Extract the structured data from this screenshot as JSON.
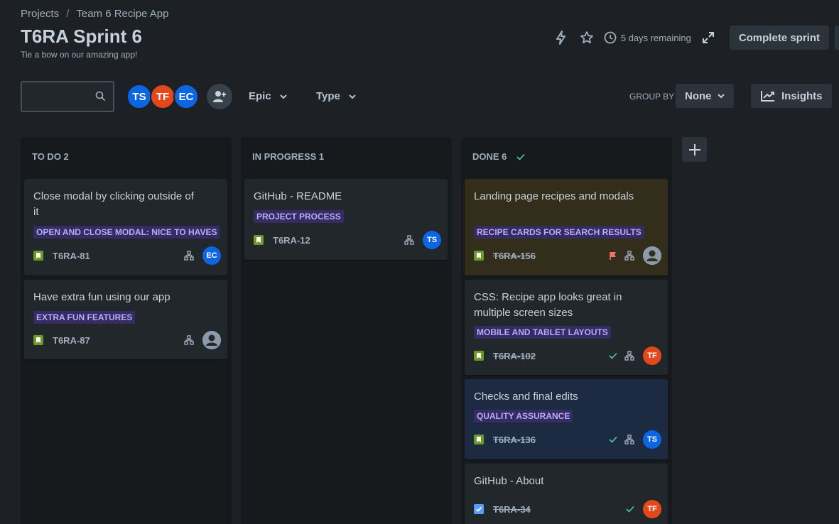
{
  "breadcrumb": {
    "root": "Projects",
    "separator": "/",
    "project": "Team 6 Recipe App"
  },
  "sprint": {
    "title": "T6RA Sprint 6",
    "goal": "Tie a bow on our amazing app!"
  },
  "top_actions": {
    "remaining": "5 days remaining",
    "complete_label": "Complete sprint"
  },
  "search": {
    "placeholder": ""
  },
  "members": [
    {
      "initials": "TS",
      "color": "#0c66e4"
    },
    {
      "initials": "TF",
      "color": "#e2481b"
    },
    {
      "initials": "EC",
      "color": "#0c66e4"
    }
  ],
  "filters": {
    "epic": "Epic",
    "type": "Type"
  },
  "group_by": {
    "label": "GROUP BY",
    "value": "None"
  },
  "insights_label": "Insights",
  "columns": [
    {
      "header": "TO DO 2",
      "cards": [
        {
          "title": "Close modal by clicking outside of it",
          "epic": "OPEN AND CLOSE MODAL: NICE TO HAVES",
          "key": "T6RA-81",
          "assignee": "EC"
        },
        {
          "title": "Have extra fun using our app",
          "epic": "EXTRA FUN FEATURES",
          "key": "T6RA-87",
          "assignee": ""
        }
      ]
    },
    {
      "header": "IN PROGRESS 1",
      "cards": [
        {
          "title": "GitHub - README",
          "epic": "PROJECT PROCESS",
          "key": "T6RA-12",
          "assignee": "TS"
        }
      ]
    },
    {
      "header": "DONE 6",
      "cards": [
        {
          "title": "Landing page recipes and modals",
          "epic": "RECIPE CARDS FOR SEARCH RESULTS",
          "key": "T6RA-156",
          "assignee": ""
        },
        {
          "title": "CSS: Recipe app looks great in multiple screen sizes",
          "epic": "MOBILE AND TABLET LAYOUTS",
          "key": "T6RA-102",
          "assignee": "TF"
        },
        {
          "title": "Checks and final edits",
          "epic": "QUALITY ASSURANCE",
          "key": "T6RA-136",
          "assignee": "TS"
        },
        {
          "title": "GitHub - About",
          "epic": "",
          "key": "T6RA-34",
          "assignee": "TF"
        }
      ]
    }
  ],
  "colors": {
    "background": "#1d2125",
    "column": "#161a1d",
    "card": "#22272b",
    "epic_bg": "#352c63",
    "epic_text": "#b8acf6",
    "story_green": "#6a9a23",
    "task_blue": "#579dff",
    "flag_red": "#f87168",
    "done_check": "#4bce97"
  }
}
